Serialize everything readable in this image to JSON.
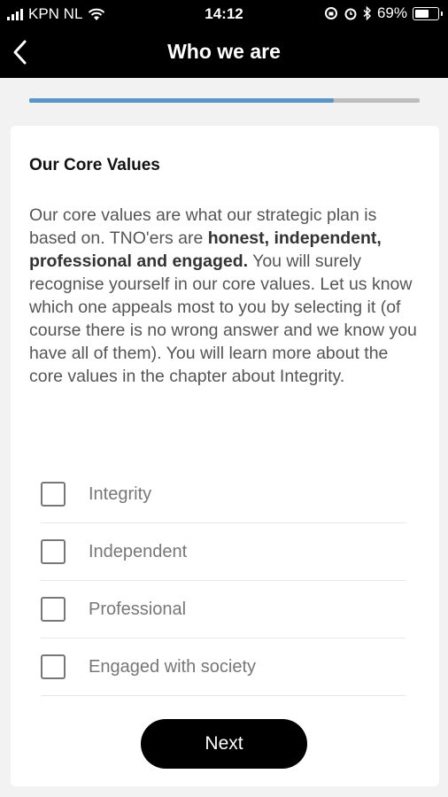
{
  "status_bar": {
    "carrier": "KPN NL",
    "time": "14:12",
    "battery": "69%",
    "battery_level": 0.69
  },
  "nav": {
    "title": "Who we are",
    "back_icon": "chevron-left-icon"
  },
  "progress": {
    "fraction": 0.78,
    "color": "#5b95c6"
  },
  "card": {
    "title": "Our Core Values",
    "body": {
      "p1": "Our core values are  what our strategic plan is based on. TNO'ers are ",
      "bold1": "honest, independent,",
      "bold2": "professional and engaged.",
      "p2": " You will surely recognise yourself in our core values. Let us know which one appeals most to you by selecting it (of course there is no wrong answer and we know you have all of them). You will learn more about the core values in the chapter about Integrity."
    },
    "options": [
      {
        "label": "Integrity",
        "checked": false
      },
      {
        "label": "Independent",
        "checked": false
      },
      {
        "label": "Professional",
        "checked": false
      },
      {
        "label": "Engaged with society",
        "checked": false
      }
    ],
    "next_label": "Next"
  }
}
